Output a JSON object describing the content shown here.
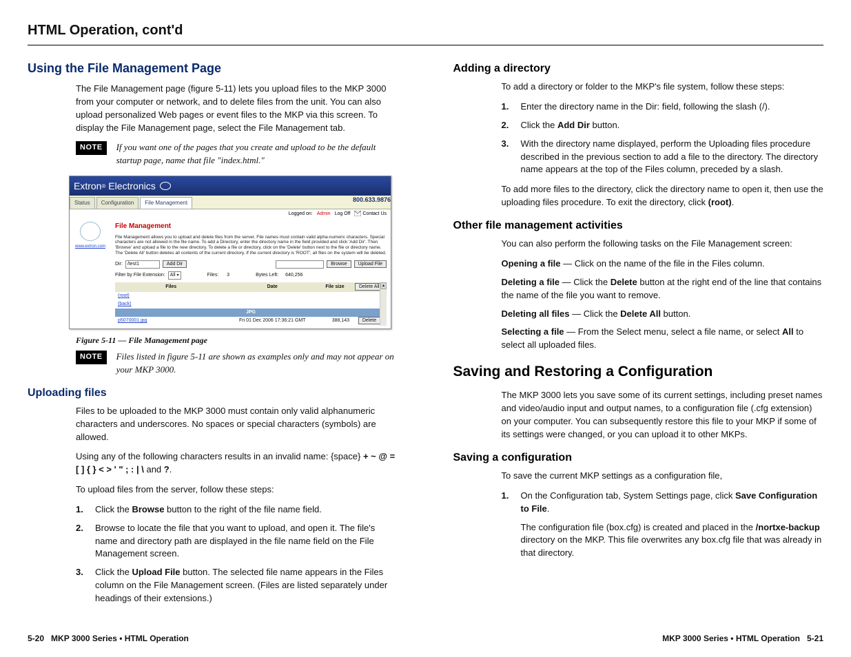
{
  "header": {
    "title": "HTML Operation, cont'd"
  },
  "left": {
    "section1": {
      "title": "Using the File Management Page",
      "p1": "The File Management page (figure 5-11) lets you upload files to the MKP 3000 from your computer or network, and to delete files from the unit.  You can also upload personalized Web pages or event files to the MKP via this screen.  To display the File Management page, select the File Management tab.",
      "note1_label": "NOTE",
      "note1": "If you want one of the pages that you create and upload to be the default startup page, name that file \"index.html.\"",
      "caption": "Figure 5-11 — File Management page",
      "note2_label": "NOTE",
      "note2": "Files listed in figure 5-11 are shown as examples only and may not appear on your MKP 3000."
    },
    "screenshot": {
      "brand": "Extron Electronics",
      "tabs": [
        "Status",
        "Configuration",
        "File Management"
      ],
      "phone": "800.633.9876",
      "logged_label": "Logged on:",
      "logged_user": "Admin",
      "logoff": "Log Off",
      "contact": "Contact Us",
      "side_link": "www.extron.com",
      "panel_title": "File Management",
      "desc": "File Management allows you to upload and delete files from the server. File names must contain valid alpha-numeric characters. Special characters are not allowed in the file name. To add a Directory, enter the directory name in the field provided and click 'Add Dir'. Then 'Browse' and upload a file to the new directory. To delete a file or directory, click on the 'Delete' button next to the file or directory name. The 'Delete All' button deletes all contents of the current directory. If the current directory is 'ROOT', all files on the system will be deleted.",
      "dir_label": "Dir:",
      "dir_value": "/test1",
      "add_dir": "Add Dir",
      "browse": "Browse",
      "upload": "Upload File",
      "filter_label": "Filter by File Extension:",
      "filter_value": "All",
      "files_label": "Files:",
      "files_count": "3",
      "bytes_label": "Bytes Left:",
      "bytes_value": "640,256",
      "th_files": "Files",
      "th_date": "Date",
      "th_size": "File size",
      "delete_all": "Delete All",
      "row_root": "(root)",
      "row_back": "(back)",
      "row_jpg": "JPG",
      "file_name": "p5070001.jpg",
      "file_date": "Fri 01 Dec 2006 17:36:21 GMT",
      "file_size": "388,143",
      "delete": "Delete"
    },
    "section2": {
      "title": "Uploading files",
      "p1": "Files to be uploaded to the MKP 3000 must contain only valid alphanumeric characters and underscores.  No spaces or special characters (symbols) are allowed.",
      "p2a": "Using any of the following characters results in an invalid name: {space}  ",
      "p2b": "+  ~  @  = [ ]  { }  <  >  '  \"  ;  :   |  \\",
      "p2c": "  and ",
      "p2d": "?",
      "p2e": ".",
      "p3": "To upload files from the server, follow these steps:",
      "li1a": "Click the ",
      "li1b": "Browse",
      "li1c": " button to the right of the file name field.",
      "li2": "Browse to locate the file that you want to upload, and open it.  The file's name and directory path are displayed in the file name field on the File Management screen.",
      "li3a": "Click the ",
      "li3b": "Upload File",
      "li3c": " button.  The selected file name appears in the Files column on the File Management screen.  (Files are listed separately under headings of their extensions.)"
    }
  },
  "right": {
    "section1": {
      "title": "Adding a directory",
      "p1": "To add a directory or folder to the MKP's file system, follow these steps:",
      "li1": "Enter the directory name in the Dir: field, following the slash (/).",
      "li2a": "Click the ",
      "li2b": "Add Dir",
      "li2c": " button.",
      "li3": "With the directory name displayed, perform the Uploading files procedure described in the previous section to add a file to the directory.  The directory name appears at the top of the Files column, preceded by a slash.",
      "p2a": "To add more files to the directory, click the directory name to open it, then use the uploading files procedure.  To exit the directory, click ",
      "p2b": "(root)",
      "p2c": "."
    },
    "section2": {
      "title": "Other file management activities",
      "p1": "You can also perform the following tasks on the File Management screen:",
      "act1a": "Opening a file",
      "act1b": " — Click on the name of the file in the Files column.",
      "act2a": "Deleting a file",
      "act2b": " — Click the ",
      "act2c": "Delete",
      "act2d": " button at the right end of the line that contains the name of the file you want to remove.",
      "act3a": "Deleting all files",
      "act3b": " — Click the ",
      "act3c": "Delete All",
      "act3d": " button.",
      "act4a": "Selecting a file",
      "act4b": " — From the Select menu, select a file name, or select ",
      "act4c": "All",
      "act4d": " to select all uploaded files."
    },
    "section3": {
      "title": "Saving and Restoring a Configuration",
      "p1": "The MKP 3000 lets you save some of its current settings, including preset names and video/audio input and output names, to a configuration file (.cfg extension) on your computer.  You can subsequently restore this file to your MKP if some of its settings were changed, or you can upload it to other MKPs."
    },
    "section4": {
      "title": "Saving a configuration",
      "p1": "To save the current MKP settings as a configuration file,",
      "li1a": "On the Configuration tab, System Settings page, click ",
      "li1b": "Save Configuration to File",
      "li1c": ".",
      "li1p2a": "The configuration file (box.cfg) is created and placed in the ",
      "li1p2b": "/nortxe-backup",
      "li1p2c": " directory on the MKP.  This file overwrites any box.cfg file that was already in that directory."
    }
  },
  "footer": {
    "left_page": "5-20",
    "left_text": "MKP 3000 Series • HTML Operation",
    "right_text": "MKP 3000 Series • HTML Operation",
    "right_page": "5-21"
  }
}
